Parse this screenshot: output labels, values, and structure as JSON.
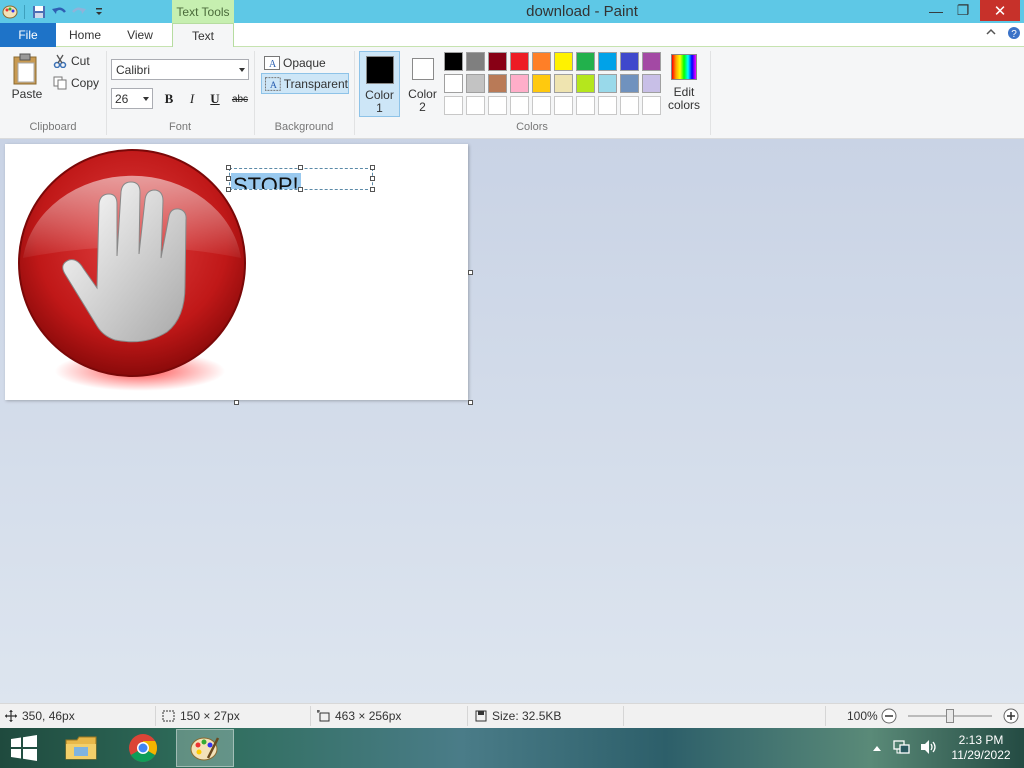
{
  "window": {
    "title": "download - Paint",
    "contextual_tab": "Text Tools",
    "minimize": "—",
    "maximize": "❐",
    "close": "✕"
  },
  "tabs": {
    "file": "File",
    "home": "Home",
    "view": "View",
    "text": "Text"
  },
  "ribbon": {
    "clipboard": {
      "label": "Clipboard",
      "paste": "Paste",
      "cut": "Cut",
      "copy": "Copy"
    },
    "font": {
      "label": "Font",
      "name": "Calibri",
      "size": "26",
      "bold": "B",
      "italic": "I",
      "underline": "U",
      "strike": "abc"
    },
    "background": {
      "label": "Background",
      "opaque": "Opaque",
      "transparent": "Transparent"
    },
    "colors": {
      "label": "Colors",
      "color1_label": "Color 1",
      "color2_label": "Color 2",
      "color1": "#000000",
      "color2": "#ffffff",
      "edit_line1": "Edit",
      "edit_line2": "colors",
      "palette_row1": [
        "#000000",
        "#7f7f7f",
        "#880015",
        "#ed1c24",
        "#ff7f27",
        "#fff200",
        "#22b14c",
        "#00a2e8",
        "#3f48cc",
        "#a349a4"
      ],
      "palette_row2": [
        "#ffffff",
        "#c3c3c3",
        "#b97a57",
        "#ffaec9",
        "#ffc90e",
        "#efe4b0",
        "#b5e61d",
        "#99d9ea",
        "#7092be",
        "#c8bfe7"
      ],
      "palette_row3": [
        "#ffffff",
        "#ffffff",
        "#ffffff",
        "#ffffff",
        "#ffffff",
        "#ffffff",
        "#ffffff",
        "#ffffff",
        "#ffffff",
        "#ffffff"
      ]
    }
  },
  "canvas": {
    "text": "STOP!",
    "icon": "stop-hand-icon"
  },
  "status": {
    "cursor": "350, 46px",
    "selection": "150 × 27px",
    "canvas_size": "463 × 256px",
    "file_size": "Size: 32.5KB",
    "zoom": "100%",
    "zoom_level": 1.0
  },
  "taskbar": {
    "apps": [
      "file-explorer",
      "google-chrome",
      "paint"
    ],
    "time": "2:13 PM",
    "date": "11/29/2022"
  }
}
